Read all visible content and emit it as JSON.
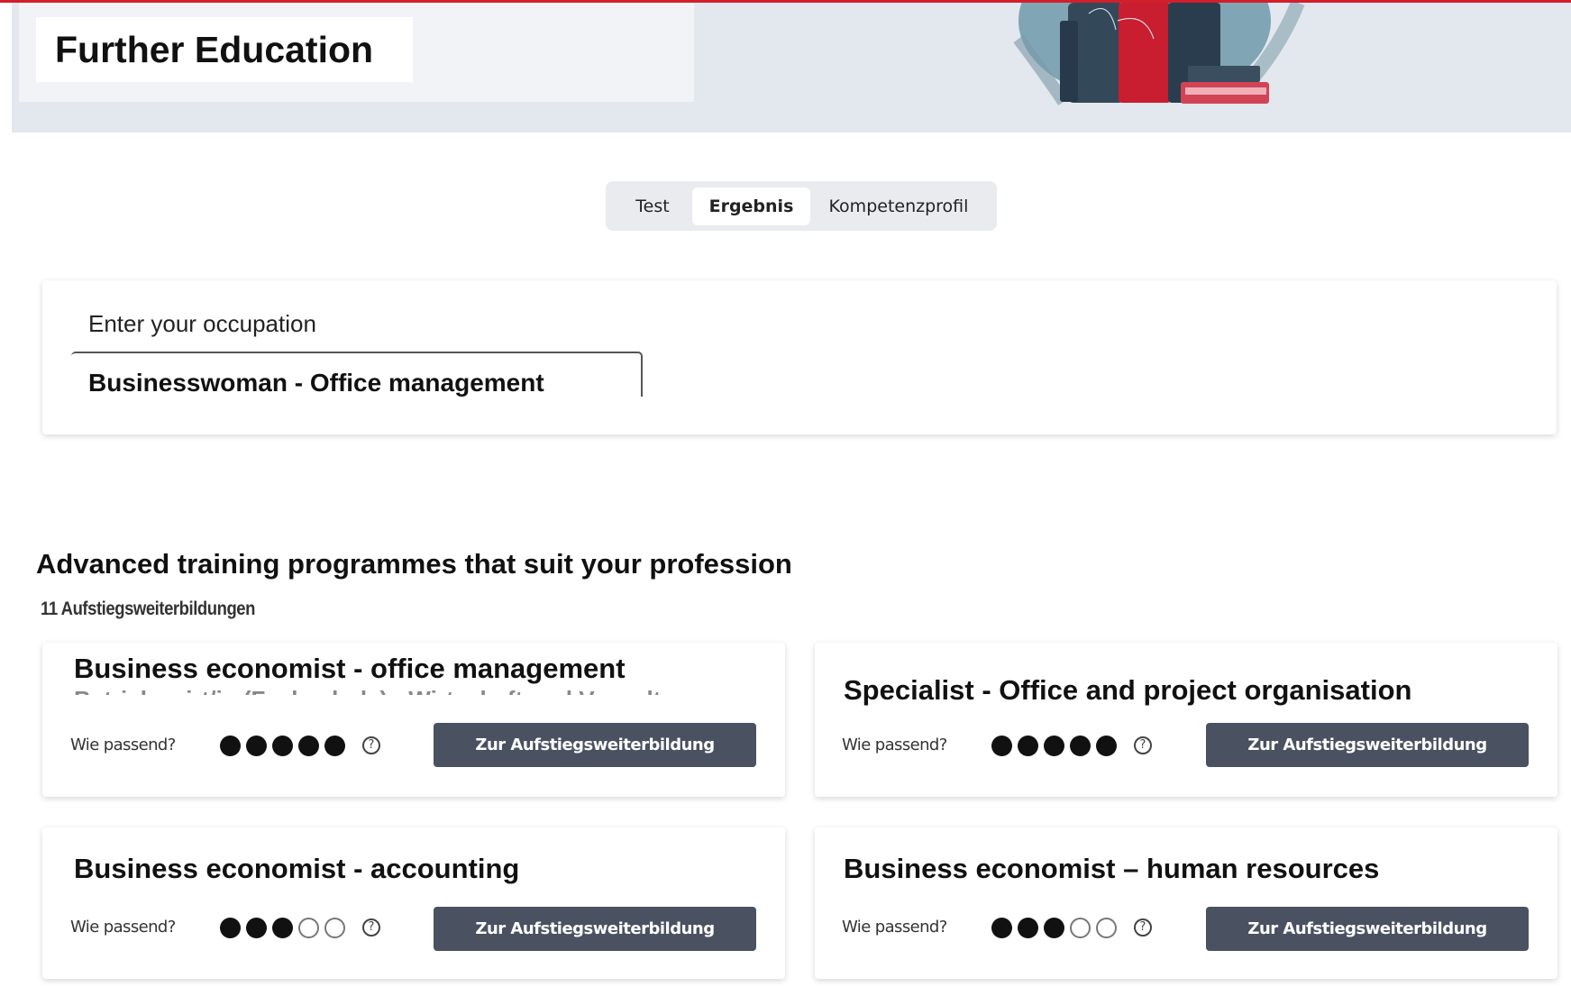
{
  "header": {
    "title": "Further Education",
    "accent_color": "#d21f2c"
  },
  "tabs": [
    {
      "label": "Test",
      "active": false
    },
    {
      "label": "Ergebnis",
      "active": true
    },
    {
      "label": "Kompetenzprofil",
      "active": false
    }
  ],
  "occupation": {
    "label": "Enter your occupation",
    "value": "Businesswoman - Office management"
  },
  "results": {
    "heading": "Advanced training programmes that suit your profession",
    "count_text": "11 Aufstiegsweiterbildungen",
    "fit_label": "Wie passend?",
    "button_label": "Zur Aufstiegsweiterbildung",
    "cards": [
      {
        "title": "Business economist - office management",
        "fit_rating": 5,
        "fit_max": 5
      },
      {
        "title": "Specialist - Office and project organisation",
        "fit_rating": 5,
        "fit_max": 5
      },
      {
        "title": "Business economist - accounting",
        "fit_rating": 3,
        "fit_max": 5
      },
      {
        "title": "Business economist – human resources",
        "fit_rating": 3,
        "fit_max": 5
      }
    ]
  },
  "icons": {
    "help": "help-circle-icon",
    "illustration": "books-illustration"
  },
  "colors": {
    "button": "#4a5160",
    "dot_filled": "#111111",
    "hero_bg": "#e3e7ee"
  }
}
